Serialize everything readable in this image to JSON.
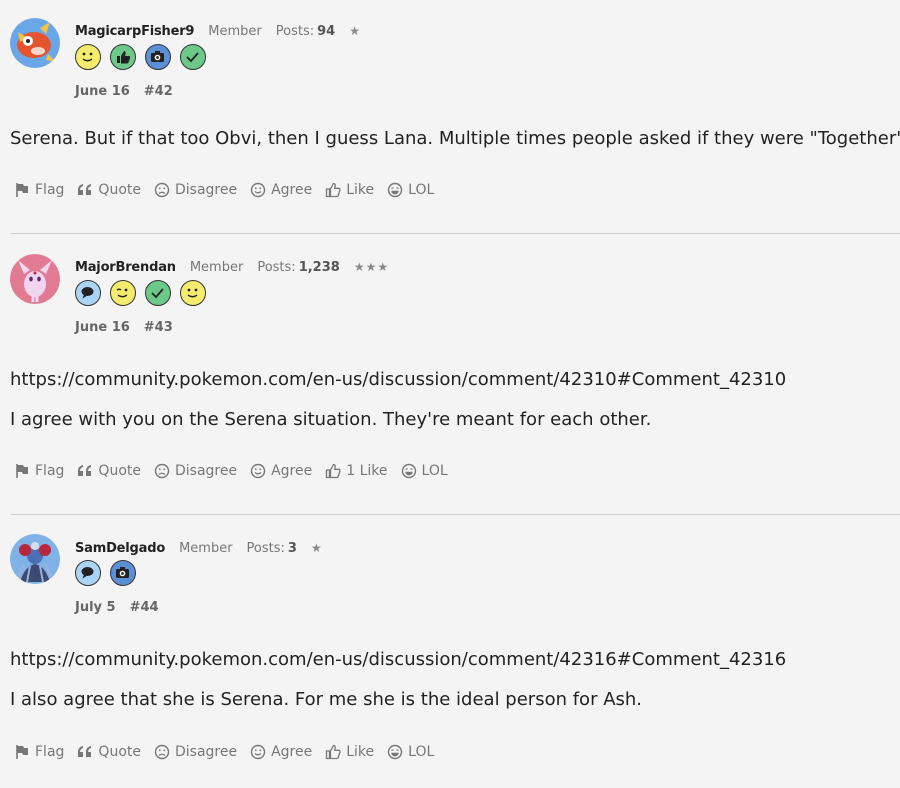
{
  "comments": [
    {
      "username": "MagicarpFisher9",
      "role": "Member",
      "posts_label": "Posts:",
      "posts_count": "94",
      "stars": "★",
      "badges": [
        "smiley-badge",
        "thumbs-up-badge",
        "camera-badge",
        "checkmark-badge"
      ],
      "date": "June 16",
      "number": "#42",
      "body": [
        "Serena. But if that too Obvi, then I guess Lana. Multiple times people asked if they were \"Together\""
      ],
      "actions": [
        "Flag",
        "Quote",
        "Disagree",
        "Agree",
        "Like",
        "LOL"
      ]
    },
    {
      "username": "MajorBrendan",
      "role": "Member",
      "posts_label": "Posts:",
      "posts_count": "1,238",
      "stars": "★★★",
      "badges": [
        "speech-bubble-badge",
        "wink-badge",
        "checkmark-badge",
        "smiley-badge"
      ],
      "date": "June 16",
      "number": "#43",
      "body": [
        "https://community.pokemon.com/en-us/discussion/comment/42310#Comment_42310",
        "I agree with you on the Serena situation. They're meant for each other."
      ],
      "actions": [
        "Flag",
        "Quote",
        "Disagree",
        "Agree",
        "1 Like",
        "LOL"
      ]
    },
    {
      "username": "SamDelgado",
      "role": "Member",
      "posts_label": "Posts:",
      "posts_count": "3",
      "stars": "★",
      "badges": [
        "speech-bubble-badge",
        "camera-badge"
      ],
      "date": "July 5",
      "number": "#44",
      "body": [
        "https://community.pokemon.com/en-us/discussion/comment/42316#Comment_42316",
        "I also agree that she is Serena. For me she is the ideal person for Ash."
      ],
      "actions": [
        "Flag",
        "Quote",
        "Disagree",
        "Agree",
        "Like",
        "LOL"
      ]
    }
  ],
  "action_icons": [
    "flag-icon",
    "quote-icon",
    "disagree-icon",
    "agree-icon",
    "like-icon",
    "lol-icon"
  ],
  "colors": {
    "background": "#f4f4f4",
    "divider": "#cfcfcf",
    "badge_yellow": "#f5ec6e",
    "badge_green": "#6dc98a",
    "badge_blue": "#5b8fd6",
    "badge_light_blue": "#a9d4f5",
    "action_gray": "#777777"
  }
}
